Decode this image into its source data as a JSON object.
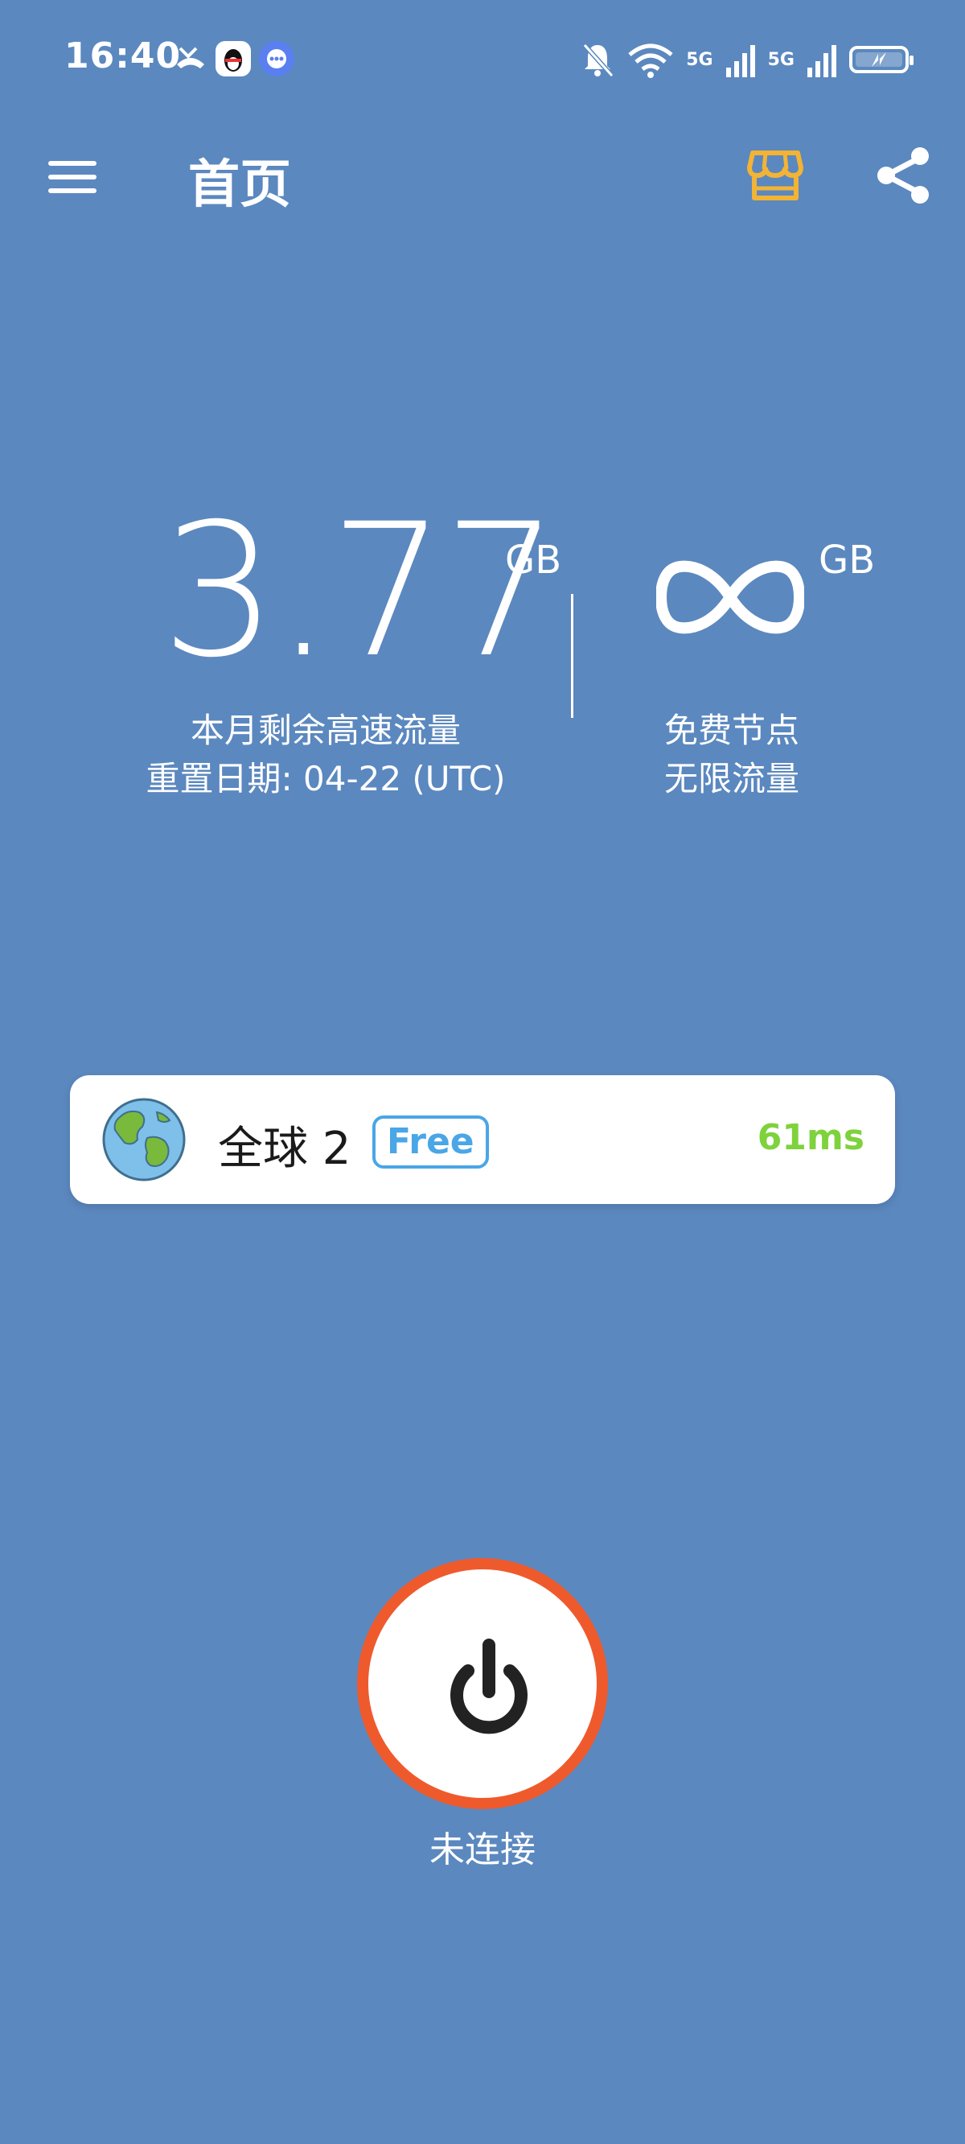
{
  "status_bar": {
    "time": "16:40",
    "net1": "5G",
    "net2": "5G",
    "icons": [
      "missed-call-icon",
      "qq-icon",
      "message-icon",
      "mute-bell-icon",
      "wifi-icon",
      "signal-icon",
      "signal-icon",
      "battery-charging-icon"
    ]
  },
  "app_bar": {
    "title": "首页",
    "menu_icon": "menu-icon",
    "store_icon": "store-icon",
    "share_icon": "share-icon",
    "store_color": "#f3b334"
  },
  "traffic": {
    "remaining_value": "3.77",
    "remaining_unit": "GB",
    "remaining_label": "本月剩余高速流量",
    "reset_label": "重置日期: 04-22 (UTC)",
    "free_unit": "GB",
    "free_label": "免费节点",
    "free_sublabel": "无限流量"
  },
  "server": {
    "name": "全球 2",
    "badge": "Free",
    "latency": "61ms",
    "badge_color": "#4aa6e6",
    "latency_color": "#7ed23c"
  },
  "connection": {
    "status": "未连接",
    "ring_color": "#ef5a2d"
  },
  "colors": {
    "background": "#5b88bf"
  }
}
